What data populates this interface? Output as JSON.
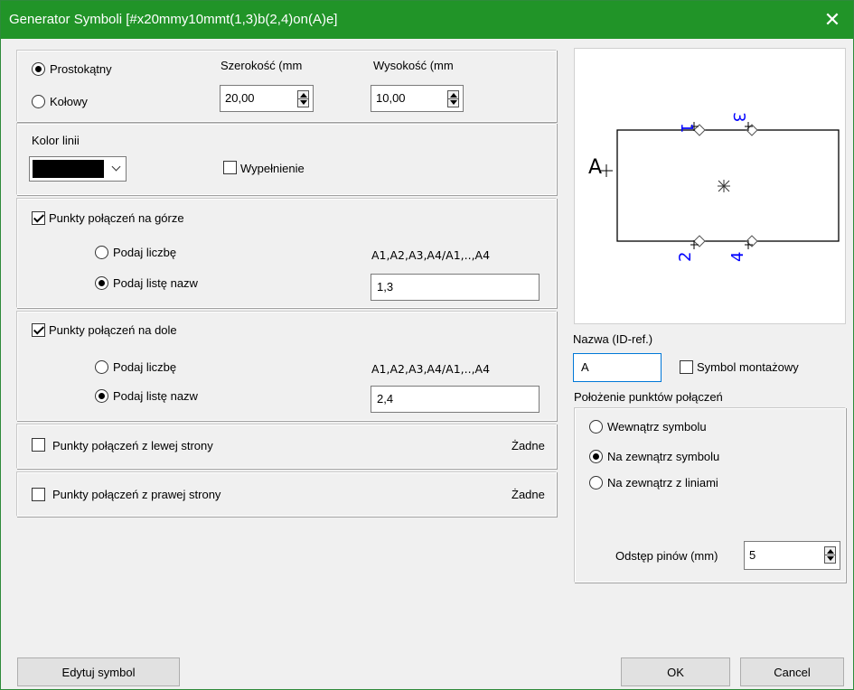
{
  "window": {
    "title": "Generator Symboli [#x20mmy10mmt(1,3)b(2,4)on(A)e]",
    "close_glyph": "✕"
  },
  "shape": {
    "rect_label": "Prostokątny",
    "circle_label": "Kołowy",
    "width_label": "Szerokość (mm",
    "width_value": "20,00",
    "height_label": "Wysokość (mm",
    "height_value": "10,00"
  },
  "line": {
    "color_label": "Kolor linii",
    "color_value": "#000000",
    "fill_label": "Wypełnienie"
  },
  "top": {
    "label": "Punkty połączeń na górze",
    "count_label": "Podaj liczbę",
    "count_hint": "A1,A2,A3,A4/A1,..,A4",
    "list_label": "Podaj listę nazw",
    "list_value": "1,3"
  },
  "bottom": {
    "label": "Punkty połączeń na dole",
    "count_label": "Podaj liczbę",
    "count_hint": "A1,A2,A3,A4/A1,..,A4",
    "list_label": "Podaj listę nazw",
    "list_value": "2,4"
  },
  "left": {
    "label": "Punkty połączeń z lewej strony",
    "value": "Żadne"
  },
  "right": {
    "label": "Punkty połączeń z prawej strony",
    "value": "Żadne"
  },
  "preview": {
    "name_text": "A",
    "pins_top": [
      "1",
      "3"
    ],
    "pins_bottom": [
      "2",
      "4"
    ]
  },
  "name": {
    "label": "Nazwa (ID-ref.)",
    "value": "A",
    "mount_label": "Symbol montażowy"
  },
  "pins_position": {
    "label": "Położenie punktów połączeń",
    "inside": "Wewnątrz symbolu",
    "outside": "Na zewnątrz symbolu",
    "outside_lines": "Na zewnątrz z liniami",
    "spacing_label": "Odstęp pinów (mm)",
    "spacing_value": "5"
  },
  "buttons": {
    "edit": "Edytuj symbol",
    "ok": "OK",
    "cancel": "Cancel"
  },
  "colors": {
    "titlebar": "#219428",
    "pin_label": "#0000ff"
  }
}
